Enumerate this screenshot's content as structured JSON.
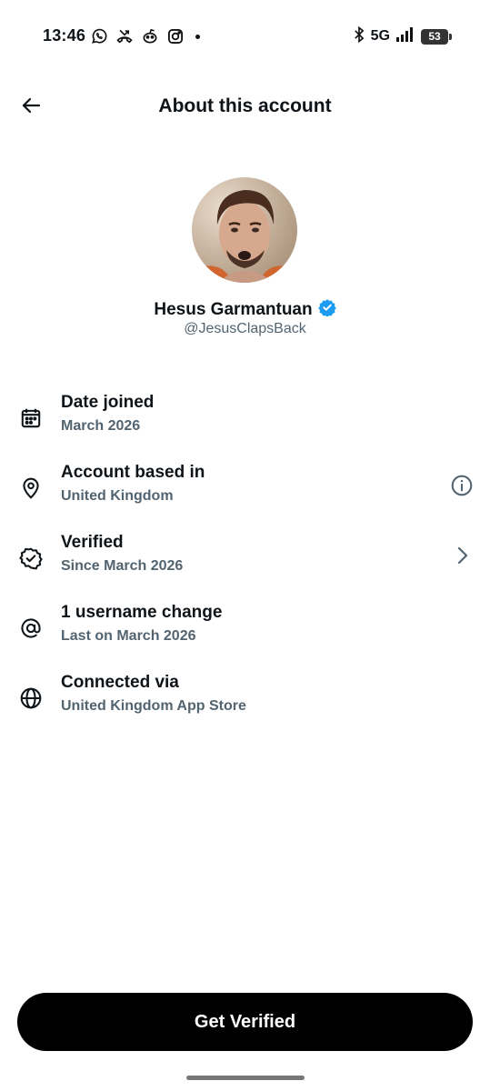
{
  "status_bar": {
    "time": "13:46",
    "left_icons": [
      "whatsapp-icon",
      "missed-call-icon",
      "reddit-icon",
      "instagram-icon",
      "notification-dot"
    ],
    "network": "5G",
    "battery": "53"
  },
  "header": {
    "title": "About this account",
    "back_icon": "arrow-left-icon"
  },
  "profile": {
    "name": "Hesus Garmantuan",
    "handle": "@JesusClapsBack",
    "verified_badge_color": "#1d9bf0"
  },
  "items": [
    {
      "label": "Date joined",
      "sub": "March 2026",
      "icon": "calendar-icon"
    },
    {
      "label": "Account based in",
      "sub": "United Kingdom",
      "icon": "location-pin-icon",
      "trailing": "info-icon"
    },
    {
      "label": "Verified",
      "sub": "Since March 2026",
      "icon": "verified-badge-icon",
      "trailing": "chevron-right-icon"
    },
    {
      "label": "1 username change",
      "sub": "Last on March 2026",
      "icon": "at-sign-icon"
    },
    {
      "label": "Connected via",
      "sub": "United Kingdom App Store",
      "icon": "globe-icon"
    }
  ],
  "cta": {
    "label": "Get Verified"
  },
  "colors": {
    "text_primary": "#0f1419",
    "text_secondary": "#536471",
    "cta_background": "#000000",
    "accent": "#1d9bf0"
  }
}
